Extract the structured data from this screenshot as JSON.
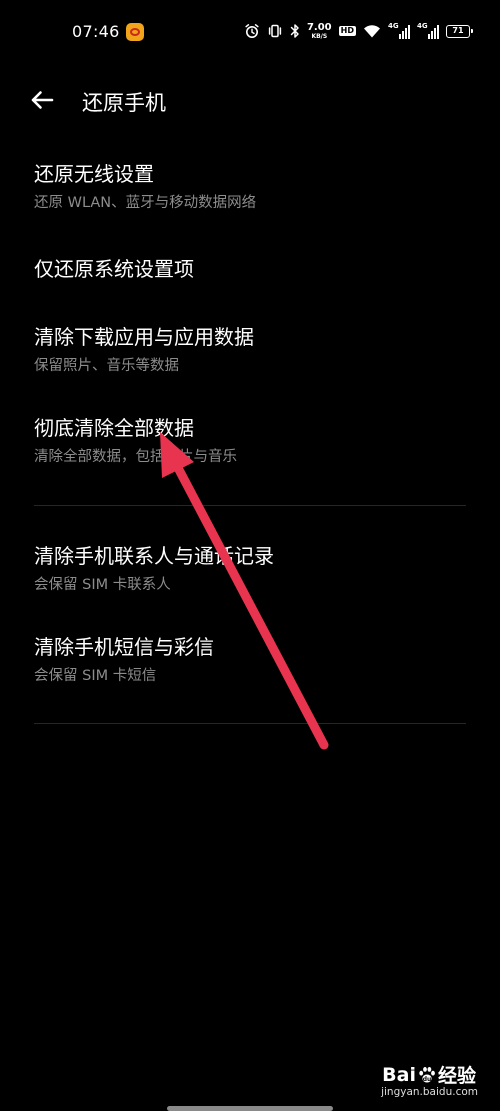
{
  "status_bar": {
    "time": "07:46",
    "net_speed_value": "7.00",
    "net_speed_unit": "KB/S",
    "hd_label": "HD",
    "sim1_label": "4G",
    "sim2_label": "4G",
    "battery_level": "71"
  },
  "header": {
    "title": "还原手机"
  },
  "items": [
    {
      "title": "还原无线设置",
      "subtitle": "还原 WLAN、蓝牙与移动数据网络"
    },
    {
      "title": "仅还原系统设置项",
      "subtitle": ""
    },
    {
      "title": "清除下载应用与应用数据",
      "subtitle": "保留照片、音乐等数据"
    },
    {
      "title": "彻底清除全部数据",
      "subtitle": "清除全部数据，包括照片与音乐"
    },
    {
      "title": "清除手机联系人与通话记录",
      "subtitle": "会保留 SIM 卡联系人"
    },
    {
      "title": "清除手机短信与彩信",
      "subtitle": "会保留 SIM 卡短信"
    }
  ],
  "annotation": {
    "color": "#e8344e"
  },
  "watermark": {
    "brand_left": "Bai",
    "brand_right": "经验",
    "url": "jingyan.baidu.com"
  },
  "icons": {
    "back": "back-arrow-icon",
    "alarm": "alarm-icon",
    "vibrate": "vibrate-icon",
    "bluetooth": "bluetooth-icon",
    "wifi": "wifi-icon"
  }
}
